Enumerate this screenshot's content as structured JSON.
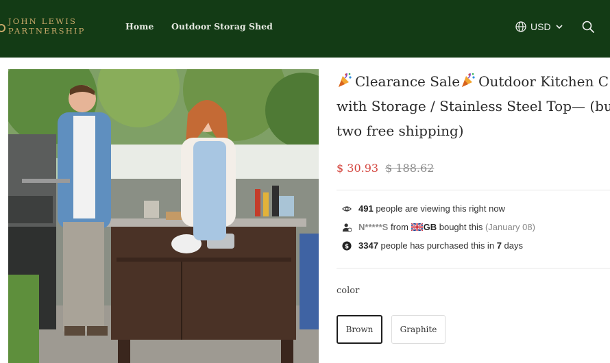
{
  "header": {
    "logo_line1": "JOHN LEWIS",
    "logo_line2": "PARTNERSHIP",
    "nav": [
      {
        "label": "Home"
      },
      {
        "label": "Outdoor Storag Shed"
      }
    ],
    "currency": "USD",
    "icons": {
      "currency": "globe-icon",
      "dropdown": "chevron-down-icon",
      "search": "search-icon"
    },
    "background": "#133b15",
    "logo_color": "#c9a96a"
  },
  "product": {
    "title_line1_part1": "Clearance Sale",
    "title_line1_part2": "Outdoor Kitchen C",
    "title_line2": "with Storage / Stainless Steel Top— (bu",
    "title_line3": "two free shipping)",
    "title_icon": "party-popper-icon",
    "price_current": "$ 30.93",
    "price_original": "$ 188.62",
    "price_color": "#d4453e"
  },
  "social_proof": {
    "viewing": {
      "icon": "eye-icon",
      "count": "491",
      "text": "people are viewing this right now"
    },
    "recent_buyer": {
      "icon": "user-icon",
      "name": "N*****S",
      "from": "from",
      "country": "GB",
      "country_flag": "uk-flag-icon",
      "action": "bought this",
      "date": "(January 08)"
    },
    "purchased": {
      "icon": "dollar-icon",
      "count": "3347",
      "text_a": "people has purchased this in",
      "days": "7",
      "text_b": "days"
    }
  },
  "options": {
    "label": "color",
    "values": [
      {
        "label": "Brown",
        "selected": true
      },
      {
        "label": "Graphite",
        "selected": false
      }
    ]
  }
}
